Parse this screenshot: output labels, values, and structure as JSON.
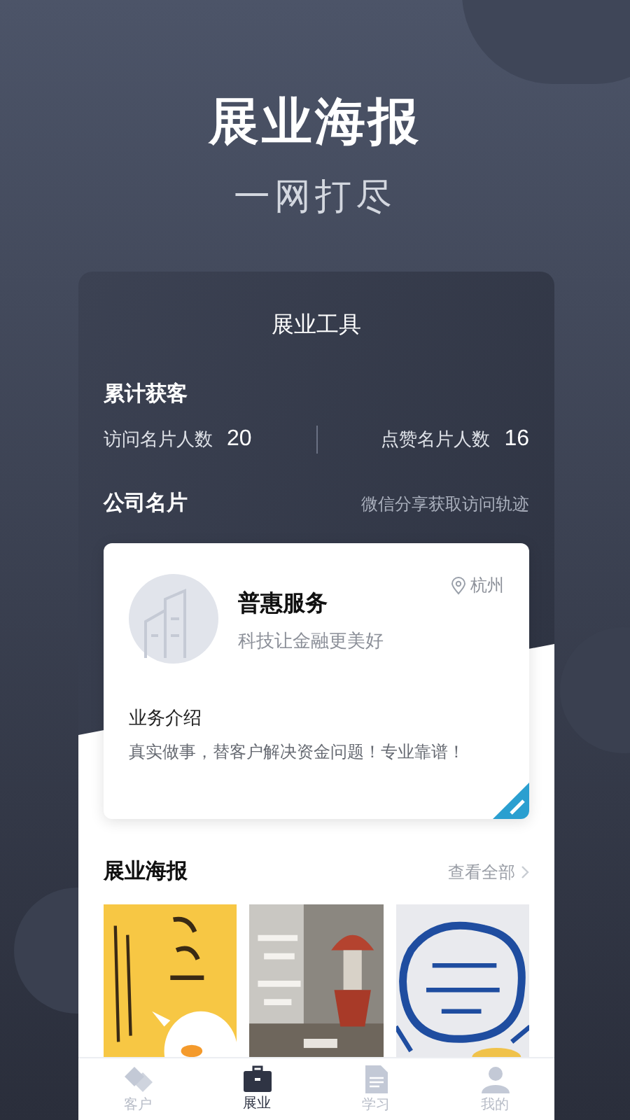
{
  "header": {
    "title": "展业海报",
    "subtitle": "一网打尽"
  },
  "screen": {
    "title": "展业工具",
    "stats": {
      "heading": "累计获客",
      "items": [
        {
          "label": "访问名片人数",
          "value": "20"
        },
        {
          "label": "点赞名片人数",
          "value": "16"
        }
      ]
    },
    "company_card": {
      "heading": "公司名片",
      "hint": "微信分享获取访问轨迹",
      "name": "普惠服务",
      "slogan": "科技让金融更美好",
      "location": "杭州",
      "intro_heading": "业务介绍",
      "intro": "真实做事，替客户解决资金问题！专业靠谱！"
    },
    "posters": {
      "heading": "展业海报",
      "more": "查看全部"
    },
    "tab_bar": [
      {
        "label": "客户",
        "kind": "handshake",
        "selected": false
      },
      {
        "label": "展业",
        "kind": "briefcase",
        "selected": true
      },
      {
        "label": "学习",
        "kind": "document",
        "selected": false
      },
      {
        "label": "我的",
        "kind": "person",
        "selected": false
      }
    ]
  }
}
